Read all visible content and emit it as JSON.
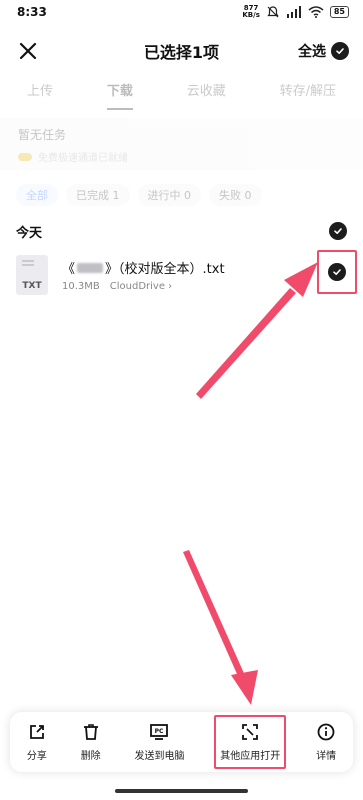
{
  "status_bar": {
    "time": "8:33",
    "net_speed_value": "877",
    "net_speed_unit": "KB/s",
    "battery": "85"
  },
  "header": {
    "title": "已选择1项",
    "select_all_label": "全选"
  },
  "tabs": [
    {
      "label": "上传",
      "active": false
    },
    {
      "label": "下载",
      "active": true
    },
    {
      "label": "云收藏",
      "active": false
    },
    {
      "label": "转存/解压",
      "active": false
    }
  ],
  "task_area": {
    "title": "暂无任务",
    "subtitle": "免费极速通道已就绪"
  },
  "filters": [
    {
      "label": "全部",
      "active": true
    },
    {
      "label": "已完成 1",
      "active": false
    },
    {
      "label": "进行中 0",
      "active": false
    },
    {
      "label": "失败 0",
      "active": false
    }
  ],
  "group": {
    "title": "今天"
  },
  "file": {
    "name_prefix": "《",
    "name_suffix": "》（校对版全本）.txt",
    "ext": "TXT",
    "size": "10.3MB",
    "location": "CloudDrive ›"
  },
  "actions": [
    {
      "label": "分享",
      "icon": "share-icon"
    },
    {
      "label": "删除",
      "icon": "trash-icon"
    },
    {
      "label": "发送到电脑",
      "icon": "send-to-pc-icon"
    },
    {
      "label": "其他应用打开",
      "icon": "open-with-icon"
    },
    {
      "label": "详情",
      "icon": "info-icon"
    }
  ],
  "colors": {
    "accent_red": "#f04b6b",
    "filter_active_blue": "#2f6bff",
    "check_dark": "#1c1c1c"
  }
}
